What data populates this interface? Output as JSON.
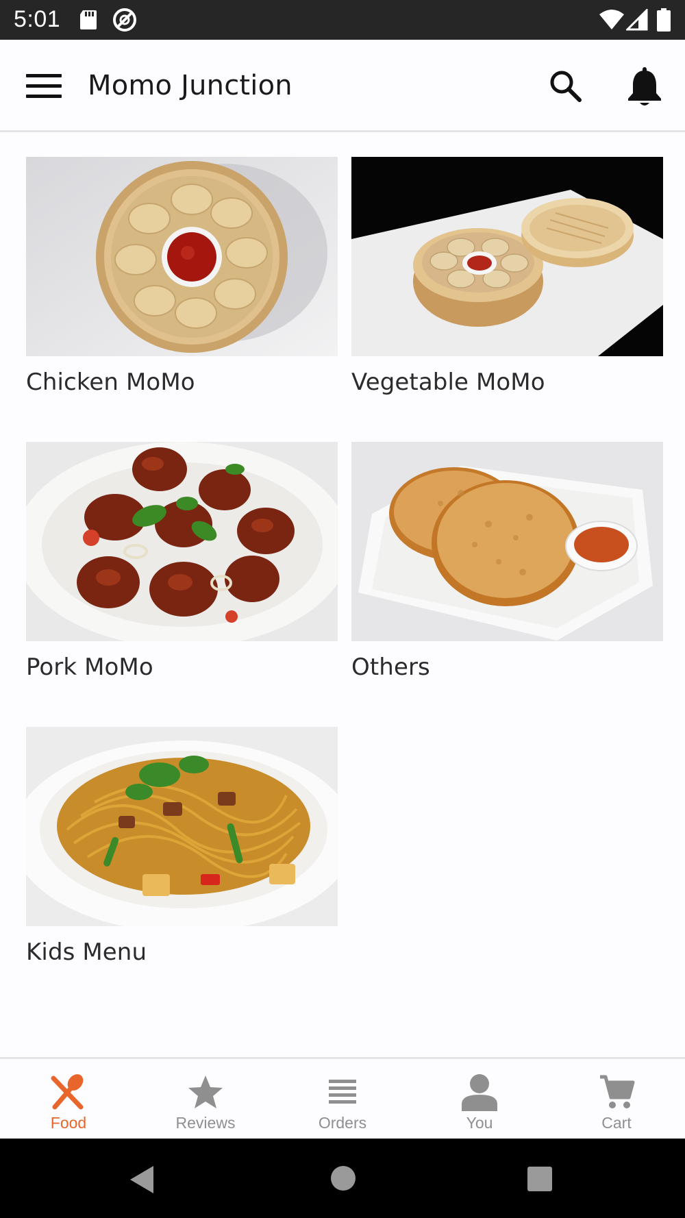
{
  "status_bar": {
    "time": "5:01",
    "left_icons": [
      "sd-card-icon",
      "data-saver-icon"
    ],
    "right_icons": [
      "wifi-icon",
      "signal-icon",
      "battery-icon"
    ]
  },
  "app_bar": {
    "title": "Momo Junction",
    "icons": [
      "menu-icon",
      "search-icon",
      "bell-icon"
    ]
  },
  "categories": [
    {
      "label": "Chicken MoMo",
      "image": "steamed momo in bamboo basket with red sauce"
    },
    {
      "label": "Vegetable MoMo",
      "image": "momo in bamboo steamer on white board"
    },
    {
      "label": "Pork MoMo",
      "image": "chilli momo with cilantro on plate"
    },
    {
      "label": "Others",
      "image": "fried turnovers with dipping sauce"
    },
    {
      "label": "Kids Menu",
      "image": "stir-fried noodles with vegetables"
    }
  ],
  "bottom_nav": {
    "items": [
      {
        "label": "Food",
        "icon": "fork-spoon-icon",
        "active": true
      },
      {
        "label": "Reviews",
        "icon": "star-icon",
        "active": false
      },
      {
        "label": "Orders",
        "icon": "list-icon",
        "active": false
      },
      {
        "label": "You",
        "icon": "person-icon",
        "active": false
      },
      {
        "label": "Cart",
        "icon": "cart-icon",
        "active": false
      }
    ],
    "active_color": "#e8652b",
    "inactive_color": "#8f8f8f"
  },
  "system_nav": [
    "back-icon",
    "home-icon",
    "recents-icon"
  ]
}
